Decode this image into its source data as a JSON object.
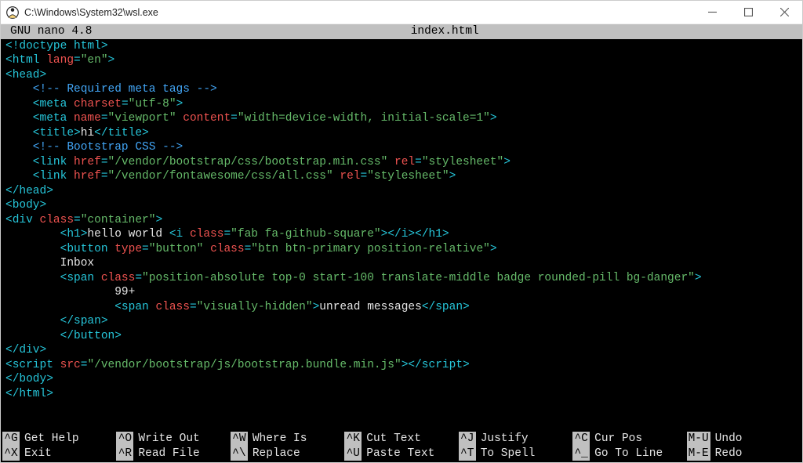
{
  "window": {
    "title": "C:\\Windows\\System32\\wsl.exe"
  },
  "nano": {
    "app": "GNU nano 4.8",
    "filename": "index.html"
  },
  "code": {
    "l1a": "<!doctype html>",
    "l2a": "<html ",
    "l2b": "lang",
    "l2c": "=",
    "l2d": "\"en\"",
    "l2e": ">",
    "l3a": "<head>",
    "l4a": "    <!-- Required meta tags -->",
    "l5a": "    <meta ",
    "l5b": "charset",
    "l5c": "=",
    "l5d": "\"utf-8\"",
    "l5e": ">",
    "l6a": "    <meta ",
    "l6b": "name",
    "l6c": "=",
    "l6d": "\"viewport\"",
    "l6e": " ",
    "l6f": "content",
    "l6g": "=",
    "l6h": "\"width=device-width, initial-scale=1\"",
    "l6i": ">",
    "l7a": "    <title>",
    "l7b": "hi",
    "l7c": "</title>",
    "l8a": "    <!-- Bootstrap CSS -->",
    "l9a": "    <link ",
    "l9b": "href",
    "l9c": "=",
    "l9d": "\"/vendor/bootstrap/css/bootstrap.min.css\"",
    "l9e": " ",
    "l9f": "rel",
    "l9g": "=",
    "l9h": "\"stylesheet\"",
    "l9i": ">",
    "l10a": "    <link ",
    "l10b": "href",
    "l10c": "=",
    "l10d": "\"/vendor/fontawesome/css/all.css\"",
    "l10e": " ",
    "l10f": "rel",
    "l10g": "=",
    "l10h": "\"stylesheet\"",
    "l10i": ">",
    "l11a": "</head>",
    "l12a": "<body>",
    "l13a": "<div ",
    "l13b": "class",
    "l13c": "=",
    "l13d": "\"container\"",
    "l13e": ">",
    "l14a": "        <h1>",
    "l14b": "hello world ",
    "l14c": "<i ",
    "l14d": "class",
    "l14e": "=",
    "l14f": "\"fab fa-github-square\"",
    "l14g": ">",
    "l14h": "</i>",
    "l14i": "</h1>",
    "l15a": "        <button ",
    "l15b": "type",
    "l15c": "=",
    "l15d": "\"button\"",
    "l15e": " ",
    "l15f": "class",
    "l15g": "=",
    "l15h": "\"btn btn-primary position-relative\"",
    "l15i": ">",
    "l16a": "        Inbox",
    "l17a": "        <span ",
    "l17b": "class",
    "l17c": "=",
    "l17d": "\"position-absolute top-0 start-100 translate-middle badge rounded-pill bg-danger\"",
    "l17e": ">",
    "l18a": "                99+",
    "l19a": "                <span ",
    "l19b": "class",
    "l19c": "=",
    "l19d": "\"visually-hidden\"",
    "l19e": ">",
    "l19f": "unread messages",
    "l19g": "</span>",
    "l20a": "        </span>",
    "l21a": "        </button>",
    "l22a": "</div>",
    "l23a": "<script ",
    "l23b": "src",
    "l23c": "=",
    "l23d": "\"/vendor/bootstrap/js/bootstrap.bundle.min.js\"",
    "l23e": ">",
    "l23f": "</script>",
    "l24a": "</body>",
    "l25a": "</html>"
  },
  "shortcuts": [
    {
      "key": "^G",
      "label": "Get Help"
    },
    {
      "key": "^O",
      "label": "Write Out"
    },
    {
      "key": "^W",
      "label": "Where Is"
    },
    {
      "key": "^K",
      "label": "Cut Text"
    },
    {
      "key": "^J",
      "label": "Justify"
    },
    {
      "key": "^C",
      "label": "Cur Pos"
    },
    {
      "key": "M-U",
      "label": "Undo"
    },
    {
      "key": "^X",
      "label": "Exit"
    },
    {
      "key": "^R",
      "label": "Read File"
    },
    {
      "key": "^\\",
      "label": "Replace"
    },
    {
      "key": "^U",
      "label": "Paste Text"
    },
    {
      "key": "^T",
      "label": "To Spell"
    },
    {
      "key": "^_",
      "label": "Go To Line"
    },
    {
      "key": "M-E",
      "label": "Redo"
    }
  ]
}
